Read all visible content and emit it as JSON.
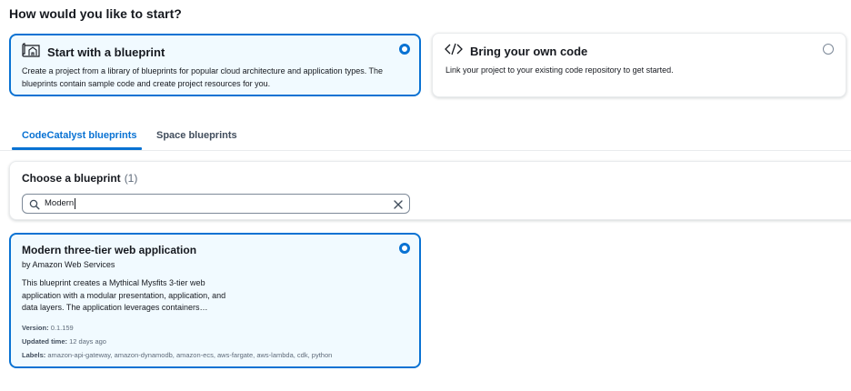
{
  "heading": "How would you like to start?",
  "options": [
    {
      "icon": "blueprint-icon",
      "title": "Start with a blueprint",
      "description": "Create a project from a library of blueprints for popular cloud architecture and application types. The blueprints contain sample code and create project resources for you.",
      "selected": true
    },
    {
      "icon": "code-icon",
      "title": "Bring your own code",
      "description": "Link your project to your existing code repository to get started.",
      "selected": false
    }
  ],
  "tabs": [
    {
      "label": "CodeCatalyst blueprints",
      "active": true
    },
    {
      "label": "Space blueprints",
      "active": false
    }
  ],
  "choose": {
    "title": "Choose a blueprint",
    "count": "(1)"
  },
  "search": {
    "value": "Modern",
    "icon": "search-icon",
    "clear_icon": "close-icon"
  },
  "blueprint_card": {
    "title": "Modern three-tier web application",
    "author": "by Amazon Web Services",
    "description": "This blueprint creates a Mythical Mysfits 3-tier web application with a modular presentation, application, and data layers. The application leverages containers…",
    "version_label": "Version:",
    "version": "0.1.159",
    "updated_label": "Updated time:",
    "updated": "12 days ago",
    "labels_label": "Labels:",
    "labels": "amazon-api-gateway, amazon-dynamodb, amazon-ecs, aws-fargate, aws-lambda, cdk, python",
    "selected": true
  },
  "colors": {
    "accent": "#0972d3",
    "selected_bg": "#f1faff",
    "text": "#16191f"
  }
}
